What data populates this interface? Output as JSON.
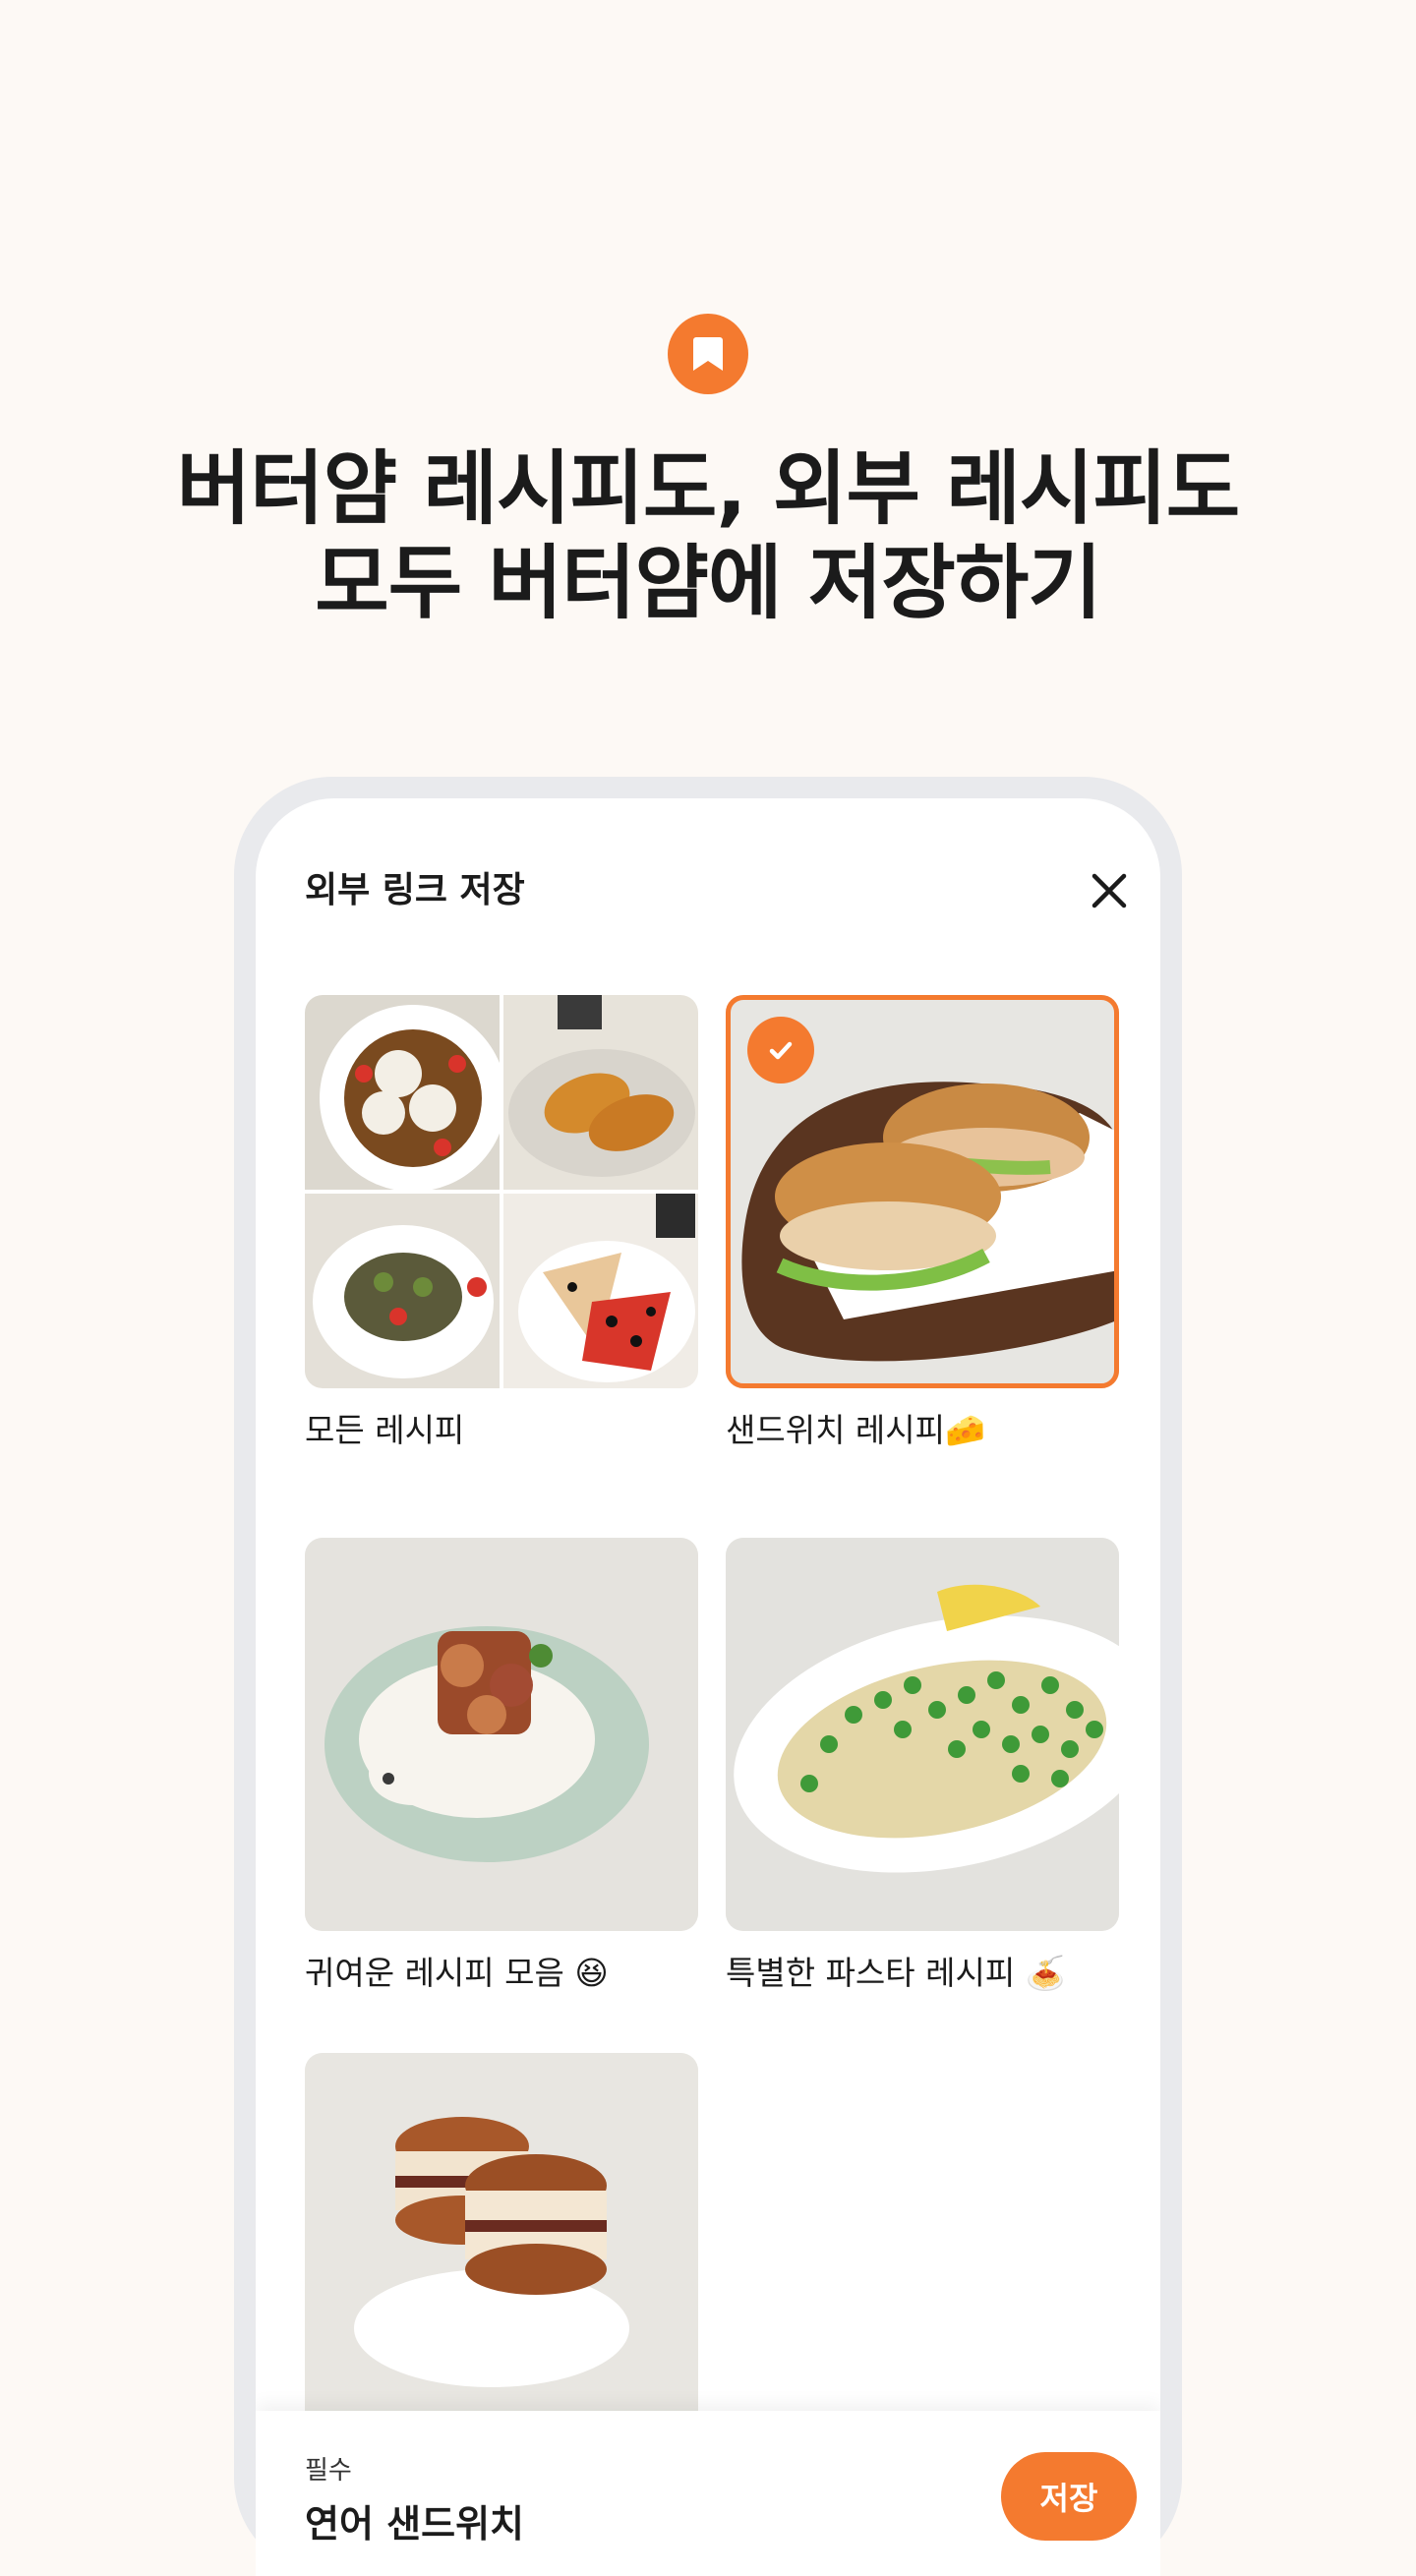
{
  "headline": {
    "line1": "버터얌 레시피도, 외부 레시피도",
    "line2": "모두 버터얌에 저장하기"
  },
  "modal": {
    "title": "외부 링크 저장",
    "close_icon": "close-icon"
  },
  "folders": [
    {
      "label": "모든 레시피",
      "selected": false
    },
    {
      "label": "샌드위치 레시피🧀",
      "selected": true
    },
    {
      "label": "귀여운 레시피 모음 😆",
      "selected": false
    },
    {
      "label": "특별한 파스타 레시피 🍝",
      "selected": false
    },
    {
      "label": "",
      "selected": false
    }
  ],
  "footer": {
    "required_label": "필수",
    "recipe_name": "연어 샌드위치",
    "save_label": "저장"
  },
  "colors": {
    "accent": "#f47a2f",
    "background": "#fdf9f5",
    "frame": "#e9eaed"
  }
}
